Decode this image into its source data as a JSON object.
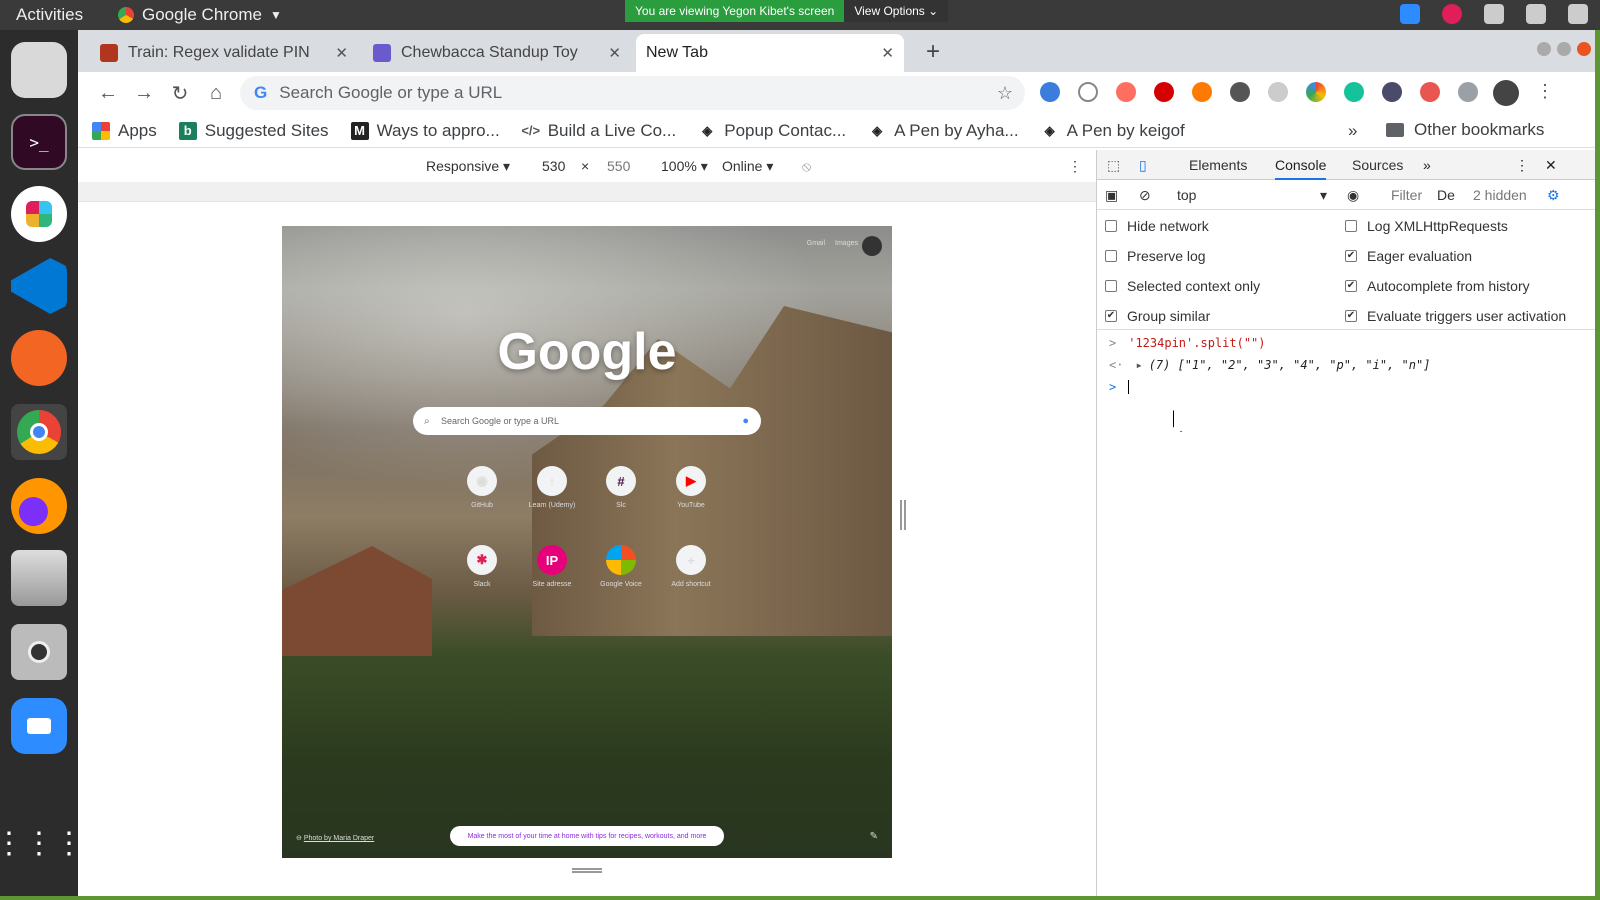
{
  "topbar": {
    "activities": "Activities",
    "app_menu": "Google Chrome",
    "sharing_message": "You are viewing Yegon Kibet's screen",
    "view_options": "View Options"
  },
  "tabs": [
    {
      "title": "Train: Regex validate PIN",
      "favicon_color": "#b1361e"
    },
    {
      "title": "Chewbacca Standup Toy",
      "favicon_color": "#6a5acd"
    },
    {
      "title": "New Tab",
      "favicon_color": ""
    }
  ],
  "omnibox": {
    "placeholder": "Search Google or type a URL"
  },
  "bookmarks": [
    {
      "label": "Apps",
      "icon": "apps-grid-icon",
      "color": "#ea4335"
    },
    {
      "label": "Suggested Sites",
      "icon": "bing-icon",
      "color": "#1a7f5a"
    },
    {
      "label": "Ways to appro...",
      "icon": "medium-icon",
      "color": "#222"
    },
    {
      "label": "Build a Live Co...",
      "icon": "code-icon",
      "color": "#555"
    },
    {
      "label": "Popup Contac...",
      "icon": "codepen-icon",
      "color": "#222"
    },
    {
      "label": "A Pen by Ayha...",
      "icon": "codepen-icon",
      "color": "#222"
    },
    {
      "label": "A Pen by keigof",
      "icon": "codepen-icon",
      "color": "#222"
    }
  ],
  "bookmarks_more": "»",
  "other_bookmarks": "Other bookmarks",
  "device_toolbar": {
    "mode": "Responsive",
    "width": "530",
    "times": "×",
    "height": "550",
    "zoom": "100%",
    "network": "Online"
  },
  "ntp": {
    "logo": "Google",
    "search_placeholder": "Search Google or type a URL",
    "top_links": [
      "Gmail",
      "Images"
    ],
    "shortcuts": [
      "GitHub",
      "Learn (Udemy)",
      "Slc",
      "YouTube",
      "Slack",
      "Site adresse",
      "Google Voice",
      "Add shortcut"
    ],
    "tip": "Make the most of your time at home with tips for recipes, workouts, and more",
    "credit": "Photo by Maria Draper"
  },
  "devtools": {
    "tabs": [
      "Elements",
      "Console",
      "Sources"
    ],
    "more": "»",
    "context": "top",
    "filter_placeholder": "Filter",
    "levels": "De",
    "hidden": "2 hidden",
    "options_left": [
      {
        "label": "Hide network",
        "checked": false
      },
      {
        "label": "Preserve log",
        "checked": false
      },
      {
        "label": "Selected context only",
        "checked": false
      },
      {
        "label": "Group similar",
        "checked": true
      }
    ],
    "options_right": [
      {
        "label": "Log XMLHttpRequests",
        "checked": false
      },
      {
        "label": "Eager evaluation",
        "checked": true
      },
      {
        "label": "Autocomplete from history",
        "checked": true
      },
      {
        "label": "Evaluate triggers user activation",
        "checked": true
      }
    ],
    "console": {
      "input": "'1234pin'.split(\"\")",
      "output": "(7) [\"1\", \"2\", \"3\", \"4\", \"p\", \"i\", \"n\"]"
    }
  }
}
